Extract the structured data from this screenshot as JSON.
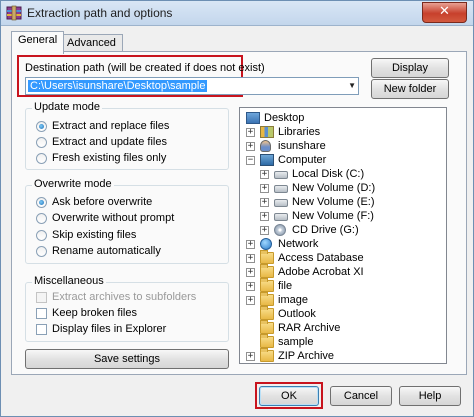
{
  "window": {
    "title": "Extraction path and options",
    "close_glyph": "✕",
    "app_icon": "winrar-icon"
  },
  "tabs": [
    {
      "label": "General",
      "active": true
    },
    {
      "label": "Advanced",
      "active": false
    }
  ],
  "destination": {
    "label": "Destination path (will be created if does not exist)",
    "value": "C:\\Users\\isunshare\\Desktop\\sample",
    "dropdown_glyph": "▼"
  },
  "buttons": {
    "display": "Display",
    "new_folder": "New folder",
    "save_settings": "Save settings",
    "ok": "OK",
    "cancel": "Cancel",
    "help": "Help"
  },
  "update_mode": {
    "title": "Update mode",
    "options": [
      {
        "label": "Extract and replace files",
        "selected": true
      },
      {
        "label": "Extract and update files",
        "selected": false
      },
      {
        "label": "Fresh existing files only",
        "selected": false
      }
    ]
  },
  "overwrite_mode": {
    "title": "Overwrite mode",
    "options": [
      {
        "label": "Ask before overwrite",
        "selected": true
      },
      {
        "label": "Overwrite without prompt",
        "selected": false
      },
      {
        "label": "Skip existing files",
        "selected": false
      },
      {
        "label": "Rename automatically",
        "selected": false
      }
    ]
  },
  "miscellaneous": {
    "title": "Miscellaneous",
    "options": [
      {
        "label": "Extract archives to subfolders",
        "checked": false,
        "disabled": true
      },
      {
        "label": "Keep broken files",
        "checked": false,
        "disabled": false
      },
      {
        "label": "Display files in Explorer",
        "checked": false,
        "disabled": false
      }
    ]
  },
  "tree": [
    {
      "label": "Desktop",
      "icon": "desktop-icon",
      "expander": ""
    },
    {
      "label": "Libraries",
      "icon": "libraries-icon",
      "expander": "+"
    },
    {
      "label": "isunshare",
      "icon": "user-icon",
      "expander": "+"
    },
    {
      "label": "Computer",
      "icon": "computer-icon",
      "expander": "−"
    },
    {
      "label": "Local Disk (C:)",
      "icon": "drive-icon",
      "expander": "+"
    },
    {
      "label": "New Volume (D:)",
      "icon": "drive-icon",
      "expander": "+"
    },
    {
      "label": "New Volume (E:)",
      "icon": "drive-icon",
      "expander": "+"
    },
    {
      "label": "New Volume (F:)",
      "icon": "drive-icon",
      "expander": "+"
    },
    {
      "label": "CD Drive (G:)",
      "icon": "cd-drive-icon",
      "expander": "+"
    },
    {
      "label": "Network",
      "icon": "network-icon",
      "expander": "+"
    },
    {
      "label": "Access Database",
      "icon": "folder-icon",
      "expander": "+"
    },
    {
      "label": "Adobe Acrobat XI",
      "icon": "folder-icon",
      "expander": "+"
    },
    {
      "label": "file",
      "icon": "folder-icon",
      "expander": "+"
    },
    {
      "label": "image",
      "icon": "folder-icon",
      "expander": "+"
    },
    {
      "label": "Outlook",
      "icon": "folder-icon",
      "expander": ""
    },
    {
      "label": "RAR Archive",
      "icon": "folder-icon",
      "expander": ""
    },
    {
      "label": "sample",
      "icon": "folder-icon",
      "expander": ""
    },
    {
      "label": "ZIP Archive",
      "icon": "folder-icon",
      "expander": "+"
    }
  ]
}
